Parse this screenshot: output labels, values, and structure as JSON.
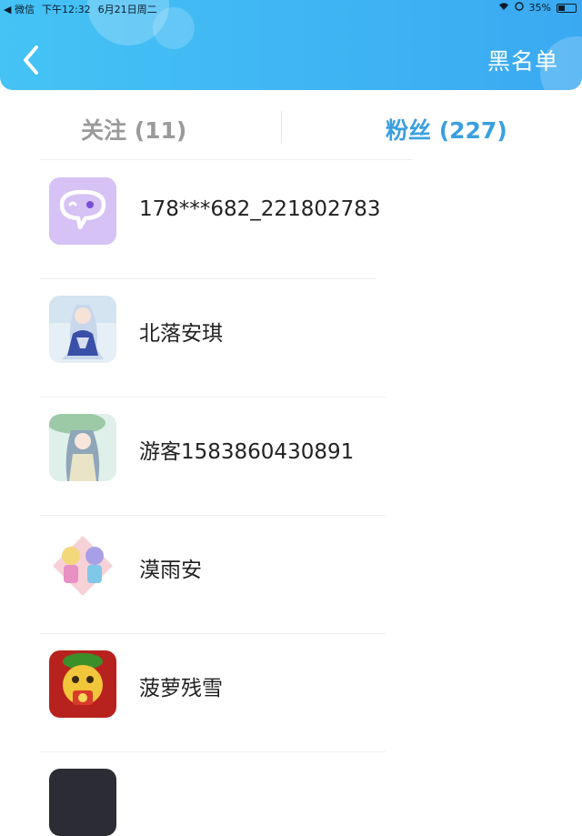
{
  "status_bar": {
    "back_app": "◀ 微信",
    "time": "下午12:32",
    "date": "6月21日周二",
    "battery": "35%"
  },
  "header": {
    "back_icon": "chevron-left-icon",
    "right_action": "黑名单"
  },
  "tabs": [
    {
      "label": "关注 (11)",
      "active": false
    },
    {
      "label": "粉丝 (227)",
      "active": true
    }
  ],
  "colors": {
    "header_start": "#45c3f5",
    "header_end": "#3aa9f2",
    "tab_active": "#3a9fe0",
    "tab_inactive": "#9a9a9a"
  },
  "fans": [
    {
      "name": "178***682_221802783",
      "avatar": "chat-bubble-avatar"
    },
    {
      "name": "北落安琪",
      "avatar": "anime-girl-blue-dress-avatar"
    },
    {
      "name": "游客1583860430891",
      "avatar": "anime-girl-umbrella-avatar"
    },
    {
      "name": "漠雨安",
      "avatar": "chibi-twins-avatar"
    },
    {
      "name": "菠萝残雪",
      "avatar": "yellow-mascot-avatar"
    }
  ]
}
